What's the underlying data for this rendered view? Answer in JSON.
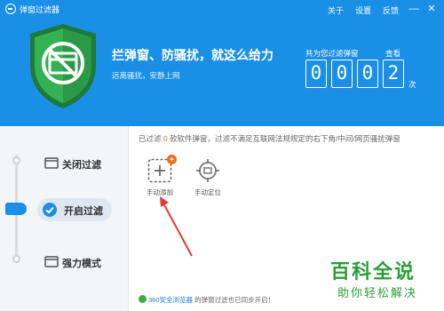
{
  "window": {
    "title": "弹窗过滤器",
    "menu": {
      "about": "关于",
      "settings": "设置",
      "feedback": "反馈"
    },
    "minimize_symbol": "—",
    "close_symbol": "✕"
  },
  "hero": {
    "slogan": "拦弹窗、防骚扰，就这么给力",
    "subslogan": "远离骚扰，安静上网",
    "counter_label": "共为您过滤弹窗",
    "view_label": "查看",
    "digits": [
      "0",
      "0",
      "0",
      "2"
    ],
    "unit": "次"
  },
  "sidebar": {
    "items": [
      {
        "label": "关闭过滤",
        "icon": "monitor-icon"
      },
      {
        "label": "开启过滤",
        "icon": "check-circle-icon"
      },
      {
        "label": "强力模式",
        "icon": "monitor-icon"
      }
    ]
  },
  "main": {
    "status_prefix": "已过滤",
    "status_count": "0",
    "status_suffix": "款软件弹窗，过滤不满足互联网法规规定的右下角/中间/网页骚扰弹窗",
    "tools": [
      {
        "label": "手动添加",
        "icon": "add-icon",
        "badge": "+"
      },
      {
        "label": "手动定位",
        "icon": "crosshair-icon"
      }
    ]
  },
  "footer": {
    "browser_name": "360安全浏览器",
    "message": "的弹窗过滤也已同步开启！"
  },
  "watermark": {
    "title": "百科全说",
    "subtitle": "助你轻松解决"
  },
  "colors": {
    "header_blue": "#1a8fe6",
    "shield_green": "#2fa84f",
    "accent_orange": "#f06c1e",
    "annotation_red": "#e53935",
    "watermark_green": "#2d9e3a"
  }
}
